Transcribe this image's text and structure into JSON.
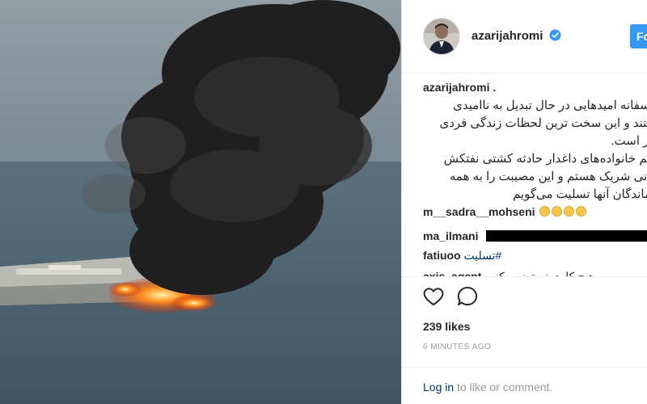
{
  "post": {
    "username": "azarijahromi",
    "follow_label": "Follow",
    "caption_user": "azarijahromi .",
    "caption_text": "متاسفانه امیدهایی در حال تبدیل به ناامیدی\nهستند و این سخت ترین لحظات زندگی فردی\nبشر است.\nبا غم خانواده‌های داغدار حادثه کشتی نفتکش\nایرانی شریک هستم و این مصیبت را به همه\nبازماندگان آنها تسلیت می‌گویم"
  },
  "comments": [
    {
      "user": "m__sadra__mohseni",
      "text": "",
      "emoji_count": 4
    },
    {
      "user": "ma_ilmani",
      "text": "",
      "redacted": true
    },
    {
      "user": "fatiuoo",
      "text": "تسلیت#"
    },
    {
      "user": "axis_agent",
      "text": "هیچ کاری نمیتونیم بکنیم"
    }
  ],
  "stats": {
    "likes": "239 likes",
    "time": "6 MINUTES AGO"
  },
  "login": {
    "link": "Log in",
    "rest": " to like or comment."
  },
  "icons": {
    "verified": "verified-badge-icon",
    "like": "heart-icon",
    "comment": "speech-bubble-icon"
  },
  "colors": {
    "accent": "#3897f0",
    "link": "#003569",
    "muted": "#999999"
  }
}
